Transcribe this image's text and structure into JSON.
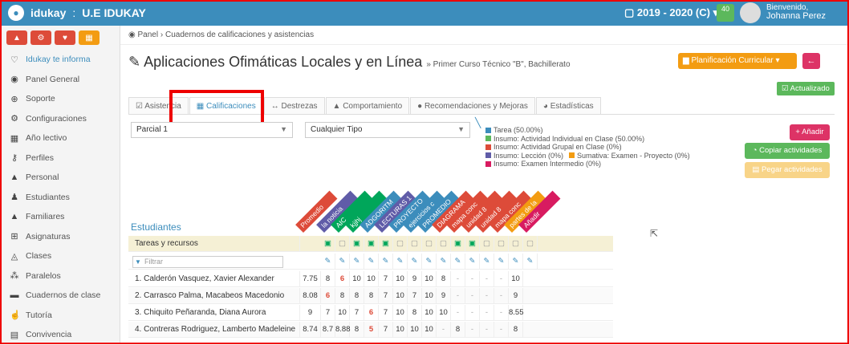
{
  "topbar": {
    "brand": "idukay",
    "institution": "U.E IDUKAY",
    "year": "2019 - 2020 (C)",
    "notifications": "40",
    "user_greeting": "Bienvenido,",
    "user_name": "Johanna Perez"
  },
  "sidebar": {
    "items": [
      {
        "label": "Idukay te informa",
        "icon": "heart-icon"
      },
      {
        "label": "Panel General",
        "icon": "dashboard-icon"
      },
      {
        "label": "Soporte",
        "icon": "support-icon"
      },
      {
        "label": "Configuraciones",
        "icon": "gear-icon"
      },
      {
        "label": "Año lectivo",
        "icon": "calendar-icon"
      },
      {
        "label": "Perfiles",
        "icon": "key-icon"
      },
      {
        "label": "Personal",
        "icon": "user-icon"
      },
      {
        "label": "Estudiantes",
        "icon": "student-icon"
      },
      {
        "label": "Familiares",
        "icon": "family-icon"
      },
      {
        "label": "Asignaturas",
        "icon": "sitemap-icon"
      },
      {
        "label": "Clases",
        "icon": "easel-icon"
      },
      {
        "label": "Paralelos",
        "icon": "group-icon"
      },
      {
        "label": "Cuadernos de clase",
        "icon": "book-icon"
      },
      {
        "label": "Tutoría",
        "icon": "thumbs-up-icon"
      },
      {
        "label": "Convivencia",
        "icon": "list-icon"
      }
    ]
  },
  "breadcrumb": {
    "root": "Panel",
    "current": "Cuadernos de calificaciones y asistencias"
  },
  "page": {
    "title": "Aplicaciones Ofimáticas Locales y en Línea",
    "subtitle": "» Primer Curso Técnico \"B\", Bachillerato",
    "plan_button": "Planificación Curricular",
    "status": "Actualizado"
  },
  "tabs": [
    "Asistencia",
    "Calificaciones",
    "Destrezas",
    "Comportamiento",
    "Recomendaciones y Mejoras",
    "Estadísticas"
  ],
  "filters": {
    "period": "Parcial 1",
    "type": "Cualquier Tipo",
    "filter_placeholder": "Filtrar"
  },
  "legend": [
    {
      "text": "Tarea (50.00%)",
      "color": "#3c8dbc"
    },
    {
      "text": "Insumo: Actividad Individual en Clase (50.00%)",
      "color": "#5cb85c"
    },
    {
      "text": "Insumo: Actividad Grupal en Clase (0%)",
      "color": "#dd4b39"
    },
    {
      "text": "Insumo: Lección (0%)",
      "color": "#605ca8"
    },
    {
      "text": "Sumativa: Examen - Proyecto (0%)",
      "color": "#f39c12"
    },
    {
      "text": "Insumo: Examen Intermedio (0%)",
      "color": "#d81b60"
    }
  ],
  "actions": {
    "add": "Añadir",
    "copy": "Copiar actividades",
    "paste": "Pegar actividades"
  },
  "grades": {
    "students_label": "Estudiantes",
    "resources_label": "Tareas y recursos",
    "columns": [
      {
        "label": "Promedio",
        "color": "#dd4b39"
      },
      {
        "label": "la noticia",
        "color": "#605ca8"
      },
      {
        "label": "AIC",
        "color": "#00a65a"
      },
      {
        "label": "kjjhj",
        "color": "#00a65a"
      },
      {
        "label": "ADGORITM",
        "color": "#3c8dbc"
      },
      {
        "label": "LECTURAS 1",
        "color": "#605ca8"
      },
      {
        "label": "PROYECTO",
        "color": "#3c8dbc"
      },
      {
        "label": "ejercicios c",
        "color": "#3c8dbc"
      },
      {
        "label": "PROMEDIO",
        "color": "#3c8dbc"
      },
      {
        "label": "DIAGRAMA",
        "color": "#dd4b39"
      },
      {
        "label": "mapa conc",
        "color": "#dd4b39"
      },
      {
        "label": "unidad 8",
        "color": "#dd4b39"
      },
      {
        "label": "unidad 8",
        "color": "#dd4b39"
      },
      {
        "label": "mapa conc",
        "color": "#dd4b39"
      },
      {
        "label": "partes de la",
        "color": "#f39c12"
      },
      {
        "label": "Añadir",
        "color": "#d81b60"
      }
    ],
    "rows": [
      {
        "name": "1. Calderón Vasquez, Xavier Alexander",
        "values": [
          "7.75",
          "8",
          "6",
          "10",
          "10",
          "7",
          "10",
          "9",
          "10",
          "8",
          "-",
          "-",
          "-",
          "-",
          "10"
        ]
      },
      {
        "name": "2. Carrasco Palma, Macabeos Macedonio",
        "values": [
          "8.08",
          "6",
          "8",
          "8",
          "8",
          "7",
          "10",
          "7",
          "10",
          "9",
          "-",
          "-",
          "-",
          "-",
          "9"
        ]
      },
      {
        "name": "3. Chiquito Peñaranda, Diana Aurora",
        "values": [
          "9",
          "7",
          "10",
          "7",
          "6",
          "7",
          "10",
          "8",
          "10",
          "10",
          "-",
          "-",
          "-",
          "-",
          "8.55"
        ]
      },
      {
        "name": "4. Contreras Rodriguez, Lamberto Madeleine",
        "values": [
          "8.74",
          "8.7",
          "8.88",
          "8",
          "5",
          "7",
          "10",
          "10",
          "10",
          "-",
          "8",
          "-",
          "-",
          "-",
          "8"
        ]
      }
    ]
  }
}
